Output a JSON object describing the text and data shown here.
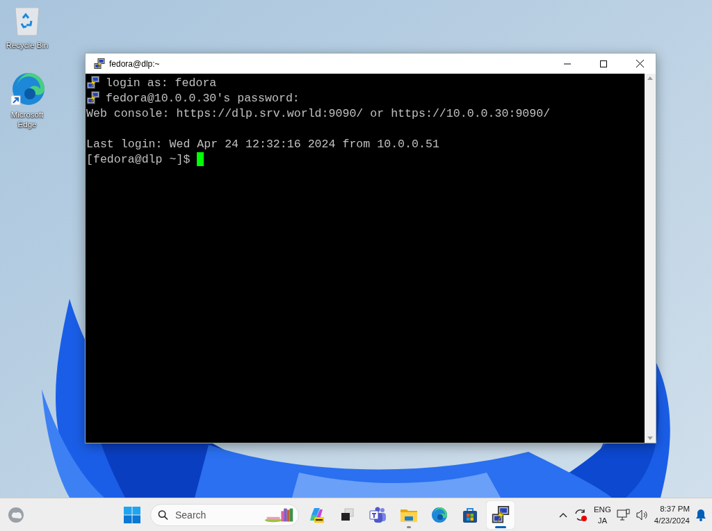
{
  "desktop_icons": [
    {
      "kind": "bin",
      "label": "Recycle Bin"
    },
    {
      "kind": "browser",
      "label": "Microsoft\nEdge",
      "shortcut": true
    }
  ],
  "window": {
    "title": "fedora@dlp:~",
    "terminal": {
      "lines": [
        {
          "kind": "icon",
          "text": "login as: fedora"
        },
        {
          "kind": "icon",
          "text": "fedora@10.0.0.30's password:"
        },
        {
          "kind": "plain",
          "text": "Web console: https://dlp.srv.world:9090/ or https://10.0.0.30:9090/"
        },
        {
          "kind": "blank"
        },
        {
          "kind": "plain",
          "text": "Last login: Wed Apr 24 12:32:16 2024 from 10.0.0.51"
        },
        {
          "kind": "input",
          "text": "[fedora@dlp ~]$"
        }
      ]
    }
  },
  "taskbar": {
    "search": {
      "placeholder": "Search"
    },
    "apps": [
      {
        "kind": "copilot",
        "running": false,
        "selected": false
      },
      {
        "kind": "taskview",
        "running": false,
        "selected": false
      },
      {
        "kind": "chat",
        "running": false,
        "selected": false
      },
      {
        "kind": "folder",
        "running": true,
        "selected": false
      },
      {
        "kind": "browser",
        "running": false,
        "selected": false
      },
      {
        "kind": "store",
        "running": false,
        "selected": false
      },
      {
        "kind": "putty",
        "running": true,
        "selected": true
      }
    ],
    "language": {
      "primary": "ENG",
      "secondary": "JA"
    },
    "time": "8:37 PM",
    "date": "4/23/2024"
  }
}
